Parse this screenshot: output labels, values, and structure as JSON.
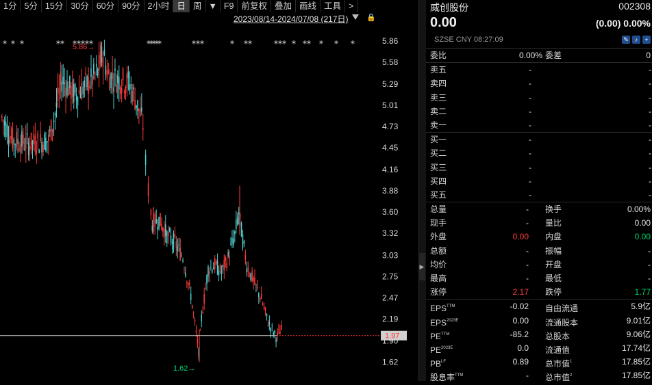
{
  "toolbar": {
    "buttons": [
      "1分",
      "5分",
      "15分",
      "30分",
      "60分",
      "90分",
      "2小时",
      "日",
      "周"
    ],
    "dropdown_arrow": "▼",
    "after": [
      "F9",
      "前复权",
      "叠加",
      "画线",
      "工具",
      ">"
    ]
  },
  "range": {
    "label": "2023/08/14-2024/07/08 (217日)"
  },
  "chart_data": {
    "type": "candlestick",
    "y_ticks": [
      "5.86",
      "5.58",
      "5.29",
      "5.01",
      "4.73",
      "4.45",
      "4.16",
      "3.88",
      "3.60",
      "3.32",
      "3.03",
      "2.75",
      "2.47",
      "2.19",
      "1.90",
      "1.62"
    ],
    "ylim": [
      1.5,
      5.95
    ],
    "high_label": "5.86",
    "low_label": "1.62",
    "current_price_label": "1.97",
    "current_price": 1.97,
    "colors": {
      "up": "#ff3b3b",
      "down": "#4fd1d1",
      "line": "#cfcfcf"
    }
  },
  "quote": {
    "name": "威创股份",
    "code": "002308",
    "price": "0.00",
    "change": "(0.00)",
    "change_pct": "0.00%",
    "meta": "SZSE  CNY  08:27:09"
  },
  "orderbook": {
    "weibi_label": "委比",
    "weibi_value": "0.00%",
    "weicha_label": "委差",
    "weicha_value": "0",
    "sells": [
      {
        "label": "卖五",
        "p": "-",
        "v": "-"
      },
      {
        "label": "卖四",
        "p": "-",
        "v": "-"
      },
      {
        "label": "卖三",
        "p": "-",
        "v": "-"
      },
      {
        "label": "卖二",
        "p": "-",
        "v": "-"
      },
      {
        "label": "卖一",
        "p": "-",
        "v": "-"
      }
    ],
    "buys": [
      {
        "label": "买一",
        "p": "-",
        "v": "-"
      },
      {
        "label": "买二",
        "p": "-",
        "v": "-"
      },
      {
        "label": "买三",
        "p": "-",
        "v": "-"
      },
      {
        "label": "买四",
        "p": "-",
        "v": "-"
      },
      {
        "label": "买五",
        "p": "-",
        "v": "-"
      }
    ]
  },
  "stats": [
    {
      "l1": "总量",
      "v1": "-",
      "l2": "换手",
      "v2": "0.00%"
    },
    {
      "l1": "现手",
      "v1": "-",
      "l2": "量比",
      "v2": "0.00"
    },
    {
      "l1": "外盘",
      "v1": "0.00",
      "l2": "内盘",
      "v2": "0.00",
      "c1": "red",
      "c2": "green"
    },
    {
      "l1": "总额",
      "v1": "-",
      "l2": "振幅",
      "v2": "-"
    },
    {
      "l1": "均价",
      "v1": "-",
      "l2": "开盘",
      "v2": "-"
    },
    {
      "l1": "最高",
      "v1": "-",
      "l2": "最低",
      "v2": "-"
    },
    {
      "l1": "涨停",
      "v1": "2.17",
      "l2": "跌停",
      "v2": "1.77",
      "c1": "red",
      "c2": "green"
    }
  ],
  "fundamentals": [
    {
      "l1": "EPS",
      "s1": "TTM",
      "v1": "-0.02",
      "l2": "自由流通",
      "s2": "",
      "v2": "5.9亿"
    },
    {
      "l1": "EPS",
      "s1": "2023E",
      "v1": "0.00",
      "l2": "流通股本",
      "s2": "",
      "v2": "9.01亿"
    },
    {
      "l1": "PE",
      "s1": "TTM",
      "v1": "-85.2",
      "l2": "总股本",
      "s2": "",
      "v2": "9.06亿"
    },
    {
      "l1": "PE",
      "s1": "2023E",
      "v1": "0.0",
      "l2": "流通值",
      "s2": "",
      "v2": "17.74亿"
    },
    {
      "l1": "PB",
      "s1": "LF",
      "v1": "0.89",
      "l2": "总市值",
      "s2": "1",
      "v2": "17.85亿"
    },
    {
      "l1": "股息率",
      "s1": "TTM",
      "v1": "-",
      "l2": "总市值",
      "s2": "2",
      "v2": "17.85亿"
    }
  ]
}
